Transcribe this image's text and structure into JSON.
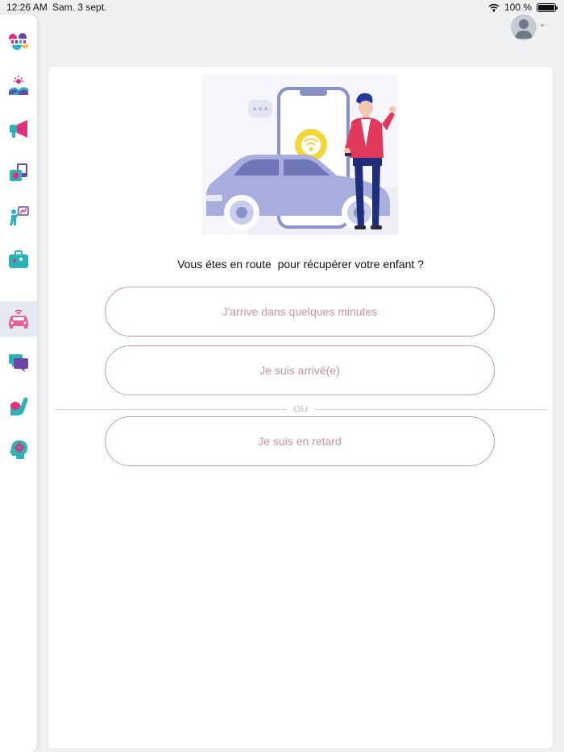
{
  "status_bar": {
    "time": "12:26 AM",
    "date": "Sam. 3 sept.",
    "battery_text": "100 %",
    "battery_level": 1.0
  },
  "sidebar": {
    "items": [
      {
        "icon": "app-logo-icon",
        "active": false
      },
      {
        "icon": "sun-landscape-icon",
        "active": false
      },
      {
        "icon": "megaphone-icon",
        "active": false
      },
      {
        "icon": "photos-icon",
        "active": false
      },
      {
        "icon": "teacher-board-icon",
        "active": false
      },
      {
        "icon": "suitcase-icon",
        "active": false
      },
      {
        "icon": "car-icon",
        "active": true
      },
      {
        "icon": "chat-icon",
        "active": false
      },
      {
        "icon": "hand-wave-icon",
        "active": false
      },
      {
        "icon": "head-gear-icon",
        "active": false
      }
    ]
  },
  "main": {
    "question": "Vous étes en route  pour récupérer votre enfant ?",
    "options": {
      "arriving": "J'arrive dans quelques minutes",
      "arrived": "Je suis arrivé(e)",
      "late": "Je suis en retard"
    },
    "separator": "OU"
  },
  "colors": {
    "accent_pink": "#c792a2",
    "border_pink": "#c89aa7",
    "teal": "#2ab3b8",
    "magenta": "#e0307e",
    "purple": "#6b47a8",
    "active_nav_bg": "#e3e8f1"
  }
}
